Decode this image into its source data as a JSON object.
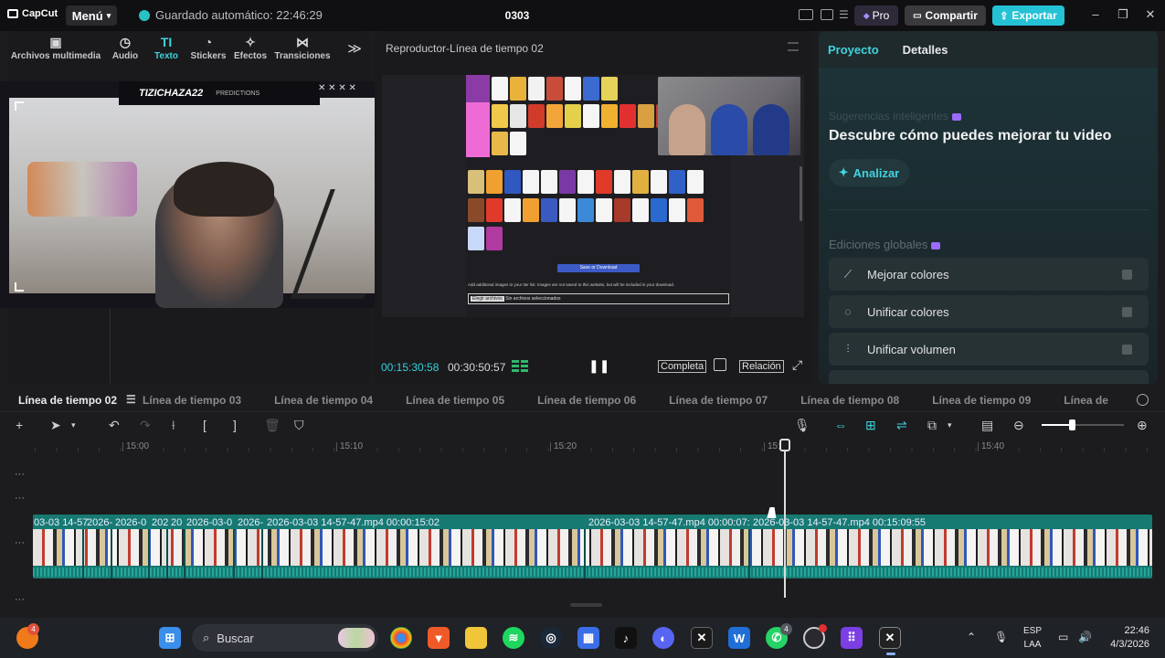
{
  "titlebar": {
    "app_name": "CapCut",
    "menu_label": "Menú",
    "autosave_text": "Guardado automático: 22:46:29",
    "project_title": "0303",
    "pro_label": "Pro",
    "share_label": "Compartir",
    "export_label": "Exportar"
  },
  "media_tabs": [
    {
      "label": "Archivos multimedia",
      "icon": "media-icon"
    },
    {
      "label": "Audio",
      "icon": "audio-icon"
    },
    {
      "label": "Texto",
      "icon": "text-icon"
    },
    {
      "label": "Stickers",
      "icon": "sticker-icon"
    },
    {
      "label": "Efectos",
      "icon": "effects-icon"
    },
    {
      "label": "Transiciones",
      "icon": "transitions-icon"
    }
  ],
  "webcam": {
    "channel_name": "TIZICHAZA22",
    "subtitle": "PREDICTIONS"
  },
  "player": {
    "title": "Reproductor-Línea de tiempo 02",
    "current_time": "00:15:30:58",
    "total_time": "00:30:50:57",
    "complete_label": "Completa",
    "ratio_label": "Relación",
    "doc_save_button": "Save or Download",
    "doc_note": "Add additional images to your tier list. Images are not saved to this website, but will be included in your download.",
    "doc_file_button": "Elegir archivos",
    "doc_file_status": "Sin archivos seleccionados"
  },
  "right_panel": {
    "tab_project": "Proyecto",
    "tab_details": "Detalles",
    "suggestions_label": "Sugerencias inteligentes",
    "suggestions_title": "Descubre cómo puedes mejorar tu video",
    "analyze_label": "Analizar",
    "global_edits_label": "Ediciones globales",
    "options": [
      {
        "label": "Mejorar colores",
        "icon": "magic-wand-icon"
      },
      {
        "label": "Unificar colores",
        "icon": "color-sync-icon"
      },
      {
        "label": "Unificar volumen",
        "icon": "sliders-icon"
      }
    ]
  },
  "timeline_tabs": [
    "Línea de tiempo 02",
    "Línea de tiempo 03",
    "Línea de tiempo 04",
    "Línea de tiempo 05",
    "Línea de tiempo 06",
    "Línea de tiempo 07",
    "Línea de tiempo 08",
    "Línea de tiempo 09",
    "Línea de"
  ],
  "ruler_labels": [
    "15:00",
    "15:10",
    "15:20",
    "15:3",
    "15:40"
  ],
  "clips": [
    {
      "label": "03-03 14-57"
    },
    {
      "label": "2026-"
    },
    {
      "label": "2026-0"
    },
    {
      "label": "202"
    },
    {
      "label": "20"
    },
    {
      "label": "2026-03-0"
    },
    {
      "label": "2026-"
    },
    {
      "label": "2026-03-03 14-57-47.mp4   00:00:15:02"
    },
    {
      "label": "2026-03-03 14-57-47.mp4   00:00:07:"
    },
    {
      "label": "2026-03-03 14-57-47.mp4   00:15:09:55"
    }
  ],
  "taskbar": {
    "search_placeholder": "Buscar",
    "lang_top": "ESP",
    "lang_bottom": "LAA",
    "time": "22:46",
    "date": "4/3/2026",
    "badge_left": "4",
    "badge_whatsapp": "4"
  },
  "colors": {
    "accent": "#3fd3de",
    "export": "#24c2d4",
    "track": "#167a72"
  }
}
